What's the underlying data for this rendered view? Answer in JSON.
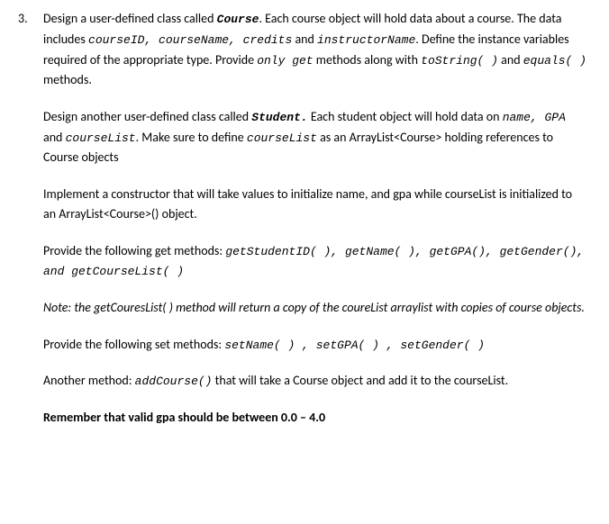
{
  "number": "3.",
  "p1_1": "Design a user-defined class called ",
  "p1_2": "Course",
  "p1_3": ". Each course object will hold data about a course. The data includes ",
  "p1_4": "courseID, courseName, credits",
  "p1_5": " and ",
  "p1_6": "instructorName",
  "p1_7": ". Define the instance variables required of the appropriate type. Provide ",
  "p1_8": "only get",
  "p1_9": " methods along with ",
  "p1_10": "toString( )",
  "p1_11": " and ",
  "p1_12": "equals( )",
  "p1_13": " methods.",
  "p2_1": "Design another user-defined class called ",
  "p2_2": "Student.",
  "p2_3": " Each student object will hold data on ",
  "p2_4": "name, GPA",
  "p2_5": " and ",
  "p2_6": "courseList",
  "p2_7": ". Make sure to define ",
  "p2_8": "courseList",
  "p2_9": " as an ArrayList<Course> holding references to Course objects",
  "p3": "Implement a constructor that will take values to initialize name, and gpa while courseList is initialized to an ArrayList<Course>() object.",
  "p4_1": "Provide the following get methods: ",
  "p4_2": "getStudentID( ), getName( ), getGPA(), getGender(), and getCourseList( )",
  "p5": "Note: the getCouresList( ) method will return a copy of the coureList arraylist with copies of course objects.",
  "p6_1": "Provide the following set methods: ",
  "p6_2": "setName( ) , setGPA( ) , setGender( )",
  "p7_1": "Another method: ",
  "p7_2": "addCourse()",
  "p7_3": " that will take a Course object and add it to the courseList.",
  "p8": "Remember that valid gpa should be between 0.0 – 4.0"
}
